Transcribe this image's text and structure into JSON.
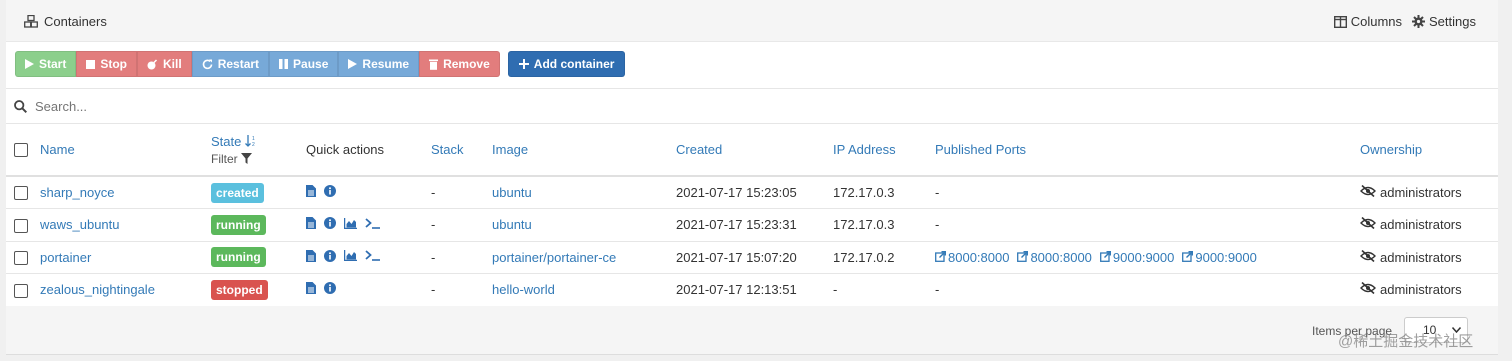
{
  "header": {
    "title": "Containers",
    "columns_label": "Columns",
    "settings_label": "Settings"
  },
  "toolbar": {
    "start": "Start",
    "stop": "Stop",
    "kill": "Kill",
    "restart": "Restart",
    "pause": "Pause",
    "resume": "Resume",
    "remove": "Remove",
    "add": "Add container"
  },
  "search": {
    "placeholder": "Search..."
  },
  "table": {
    "headers": {
      "name": "Name",
      "state": "State",
      "filter": "Filter",
      "quick_actions": "Quick actions",
      "stack": "Stack",
      "image": "Image",
      "created": "Created",
      "ip": "IP Address",
      "ports": "Published Ports",
      "ownership": "Ownership"
    },
    "rows": [
      {
        "name": "sharp_noyce",
        "state": "created",
        "stack": "-",
        "image": "ubuntu",
        "created": "2021-07-17 15:23:05",
        "ip": "172.17.0.3",
        "ports": "-",
        "ownership": "administrators"
      },
      {
        "name": "waws_ubuntu",
        "state": "running",
        "stack": "-",
        "image": "ubuntu",
        "created": "2021-07-17 15:23:31",
        "ip": "172.17.0.3",
        "ports": "-",
        "ownership": "administrators"
      },
      {
        "name": "portainer",
        "state": "running",
        "stack": "-",
        "image": "portainer/portainer-ce",
        "created": "2021-07-17 15:07:20",
        "ip": "172.17.0.2",
        "ports": [
          "8000:8000",
          "8000:8000",
          "9000:9000",
          "9000:9000"
        ],
        "ownership": "administrators"
      },
      {
        "name": "zealous_nightingale",
        "state": "stopped",
        "stack": "-",
        "image": "hello-world",
        "created": "2021-07-17 12:13:51",
        "ip": "-",
        "ports": "-",
        "ownership": "administrators"
      }
    ]
  },
  "footer": {
    "items_per_page_label": "Items per page",
    "items_per_page_value": "10"
  },
  "watermark": "@稀土掘金技术社区",
  "colors": {
    "created": "#5bc0de",
    "running": "#5cb85c",
    "stopped": "#d9534f",
    "link": "#337ab7"
  }
}
